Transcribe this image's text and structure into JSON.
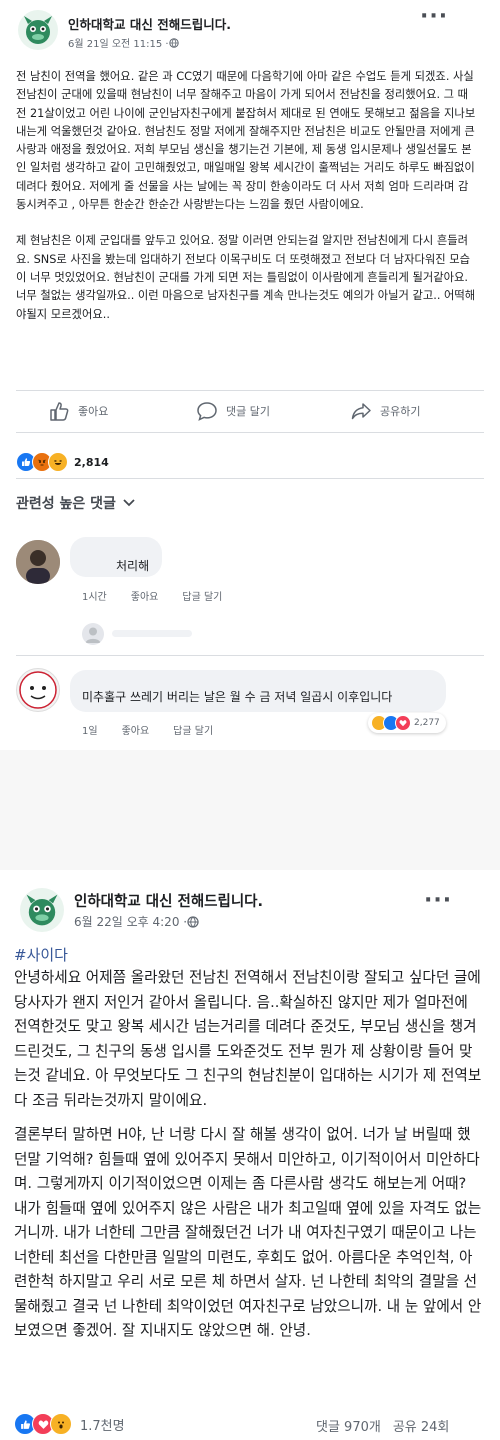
{
  "post1": {
    "page_name": "인하대학교 대신 전해드립니다.",
    "time": "6월 21일 오전 11:15 · ",
    "globe_icon": "globe-icon",
    "paragraphs": [
      "전 남친이 전역을 했어요. 같은 과 CC였기 때문에 다음학기에 아마 같은 수업도 듣게 되겠죠. 사실 전남친이 군대에 있을때 현남친이 너무 잘해주고 마음이 가게 되어서 전남친을 정리했어요. 그 때 전 21살이었고 어린 나이에 군인남자친구에게 붙잡혀서 제대로 된 연애도 못해보고 젊음을 지나보내는게 억울했던것 같아요. 현남친도 정말 저에게 잘해주지만 전남친은 비교도 안될만큼 저에게 큰 사랑과 애정을 줬었어요. 저희 부모님 생신을 챙기는건 기본에, 제 동생 입시문제나 생일선물도 본인 일처럼 생각하고 같이 고민해줬었고, 매일매일 왕복 세시간이 훌쩍넘는 거리도 하루도 빠짐없이 데려다 줬어요. 저에게 줄 선물을 사는 날에는 꼭 장미 한송이라도 더 사서 저희 엄마 드리라며 감동시켜주고 , 아무튼 한순간 한순간 사랑받는다는 느낌을 줬던 사람이에요.",
      "제 현남친은 이제 군입대를 앞두고 있어요. 정말 이러면 안되는걸 알지만 전남친에게 다시 흔들려요. SNS로 사진을 봤는데 입대하기 전보다 이목구비도 더 또렷해졌고 전보다 더 남자다워진 모습이 너무 멋있었어요. 현남친이 군대를 가게 되면 저는 틀림없이 이사람에게 흔들리게 될거같아요. 너무 철없는 생각일까요.. 이런 마음으로 남자친구를 계속 만나는것도 예의가 아닐거 같고.. 어떡해야될지 모르겠어요.."
    ],
    "actions": {
      "like": "좋아요",
      "comment": "댓글 달기",
      "share": "공유하기"
    },
    "reaction_count": "2,814",
    "comments_filter": "관련성 높은 댓글",
    "comments": [
      {
        "name": "",
        "text": "처리해",
        "time": "1시간",
        "like": "좋아요",
        "reply": "답글 달기"
      },
      {
        "name": "",
        "text": "미추홀구 쓰레기 버리는 날은 월 수 금 저녁 일곱시 이후입니다",
        "time": "1일",
        "like": "좋아요",
        "reply": "답글 달기",
        "reaction_count": "2,277"
      }
    ]
  },
  "post2": {
    "page_name": "인하대학교 대신 전해드립니다.",
    "time": "6월 22일 오후 4:20 · ",
    "hashtag": "#사이다",
    "paragraphs": [
      "안녕하세요 어제쯤 올라왔던 전남친 전역해서 전남친이랑 잘되고 싶다던 글에 당사자가 왠지 저인거 같아서 올립니다. 음..확실하진 않지만 제가 얼마전에 전역한것도 맞고 왕복 세시간 넘는거리를 데려다 준것도, 부모님 생신을 챙겨드린것도, 그 친구의 동생 입시를 도와준것도 전부 뭔가 제 상황이랑 들어 맞는것 같네요. 아 무엇보다도 그 친구의 현남친분이 입대하는 시기가 제 전역보다 조금 뒤라는것까지 말이에요.",
      "결론부터 말하면 H야, 난 너랑 다시 잘 해볼 생각이 없어. 너가 날 버릴때 했던말 기억해? 힘들때 옆에 있어주지 못해서 미안하고, 이기적이어서 미안하다며. 그렇게까지 이기적이었으면 이제는 좀 다른사람 생각도 해보는게 어때? 내가 힘들때 옆에 있어주지 않은 사람은 내가 최고일때 옆에 있을 자격도 없는거니까. 내가 너한테 그만큼 잘해줬던건 너가 내 여자친구였기 때문이고 나는 너한테 최선을 다한만큼 일말의 미련도, 후회도 없어. 아름다운 추억인척, 아련한척 하지말고 우리 서로 모른 체 하면서 살자. 넌 나한테 최악의 결말을 선물해줬고 결국 넌 나한테 최악이었던 여자친구로 남았으니까. 내 눈 앞에서 안보였으면 좋겠어. 잘 지내지도 않았으면 해. 안녕."
    ],
    "reaction_count": "1.7천명",
    "comment_count": "댓글 970개",
    "share_count": "공유 24회"
  },
  "colors": {
    "link": "#385898",
    "meta": "#606770",
    "like_blue": "#1877f2",
    "love_red": "#f33e58",
    "haha_yellow": "#f7b125"
  }
}
